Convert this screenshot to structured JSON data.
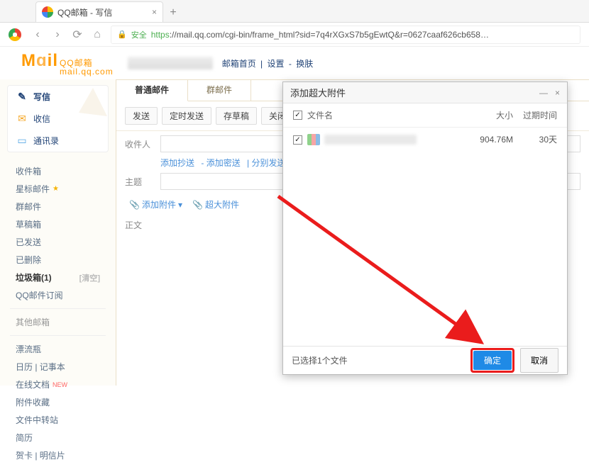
{
  "browser": {
    "tab_title": "QQ邮箱 - 写信",
    "secure_label": "安全",
    "url_prefix": "https",
    "url_rest": "://mail.qq.com/cgi-bin/frame_html?sid=7q4rXGxS7b5gEwtQ&r=0627caaf626cb658…"
  },
  "header": {
    "logo_main": "M",
    "logo_mid": "il",
    "logo_cn": "QQ邮箱",
    "logo_sub": "mail.qq.com",
    "links": {
      "home": "邮箱首页",
      "set": "设置",
      "skin": "换肤"
    }
  },
  "sidebar": {
    "write": "写信",
    "inbox_btn": "收信",
    "contacts": "通讯录",
    "items": {
      "inbox": "收件箱",
      "star": "星标邮件",
      "group": "群邮件",
      "drafts": "草稿箱",
      "sent": "已发送",
      "deleted": "已删除",
      "spam": "垃圾箱(1)",
      "spam_clear": "[清空]",
      "sub": "QQ邮件订阅",
      "other": "其他邮箱",
      "bottle": "漂流瓶",
      "calendar": "日历 | 记事本",
      "doc": "在线文档",
      "new": "NEW",
      "fav": "附件收藏",
      "transit": "文件中转站",
      "resume": "简历",
      "card": "贺卡 | 明信片"
    }
  },
  "compose": {
    "tabs": {
      "normal": "普通邮件",
      "group": "群邮件"
    },
    "toolbar": {
      "send": "发送",
      "timed": "定时发送",
      "draft": "存草稿",
      "close": "关闭"
    },
    "fields": {
      "to": "收件人",
      "subject": "主题",
      "body": "正文"
    },
    "sublinks": {
      "cc": "添加抄送",
      "bcc": "添加密送",
      "sep": "分别发送"
    },
    "attach": {
      "normal": "添加附件",
      "large": "超大附件"
    }
  },
  "dialog": {
    "title": "添加超大附件",
    "cols": {
      "name": "文件名",
      "size": "大小",
      "expire": "过期时间"
    },
    "file": {
      "size": "904.76M",
      "expire": "30天"
    },
    "status": "已选择1个文件",
    "ok": "确定",
    "cancel": "取消"
  }
}
